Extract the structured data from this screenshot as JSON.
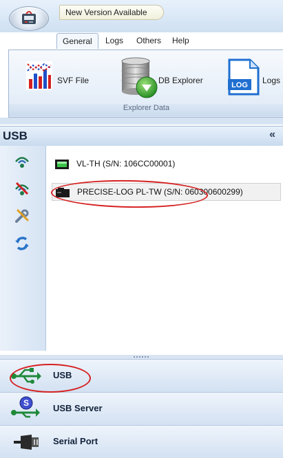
{
  "window": {
    "quick_access_text": "New Version Available"
  },
  "ribbon": {
    "tabs": [
      {
        "label": "General",
        "active": true
      },
      {
        "label": "Logs"
      },
      {
        "label": "Others"
      },
      {
        "label": "Help"
      }
    ],
    "buttons": [
      {
        "label": "SVF File",
        "icon": "chart-icon"
      },
      {
        "label": "DB Explorer",
        "icon": "database-icon"
      },
      {
        "label": "Logs",
        "icon": "log-file-icon"
      }
    ],
    "group_label": "Explorer Data"
  },
  "pane": {
    "title": "USB",
    "collapse_glyph": "«"
  },
  "rail_icons": [
    "usb-connect-icon",
    "usb-disconnect-icon",
    "tools-icon",
    "refresh-icon"
  ],
  "devices": [
    {
      "label": "VL-TH (S/N: 106CC00001)",
      "icon": "logger-device-icon"
    },
    {
      "label": "PRECISE-LOG PL-TW (S/N: 060300600299)",
      "icon": "logger-device-icon",
      "selected": true
    }
  ],
  "nav": [
    {
      "label": "USB",
      "icon": "usb-icon"
    },
    {
      "label": "USB Server",
      "icon": "usb-server-icon"
    },
    {
      "label": "Serial Port",
      "icon": "serial-port-icon"
    }
  ],
  "colors": {
    "accent": "#cfe0f2",
    "annotation": "#d62020"
  }
}
